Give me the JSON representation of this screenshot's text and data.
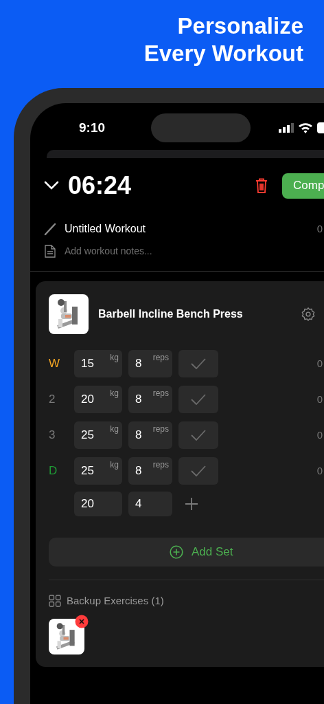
{
  "headline": "Personalize Every Workout",
  "status_bar": {
    "time": "9:10"
  },
  "header": {
    "timer": "06:24",
    "complete_button": "Comp"
  },
  "workout": {
    "title": "Untitled Workout",
    "trailing": "0",
    "notes_placeholder": "Add workout notes..."
  },
  "exercise": {
    "name": "Barbell Incline Bench Press",
    "sets": [
      {
        "label": "W",
        "kind": "warmup",
        "weight": "15",
        "weight_unit": "kg",
        "reps": "8",
        "reps_unit": "reps",
        "completed": false,
        "column_5": "0"
      },
      {
        "label": "2",
        "kind": "normal",
        "weight": "20",
        "weight_unit": "kg",
        "reps": "8",
        "reps_unit": "reps",
        "completed": false,
        "column_5": "0"
      },
      {
        "label": "3",
        "kind": "normal",
        "weight": "25",
        "weight_unit": "kg",
        "reps": "8",
        "reps_unit": "reps",
        "completed": false,
        "column_5": "0"
      },
      {
        "label": "D",
        "kind": "drop",
        "weight": "25",
        "weight_unit": "kg",
        "reps": "8",
        "reps_unit": "reps",
        "completed": false,
        "column_5": "0"
      }
    ],
    "new_set": {
      "weight": "20",
      "reps": "4"
    },
    "add_set_button": "Add Set",
    "backup": {
      "title": "Backup Exercises (1)"
    }
  }
}
